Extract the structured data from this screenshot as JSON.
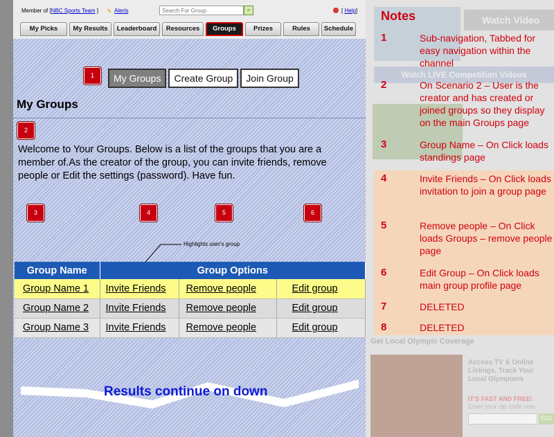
{
  "header": {
    "member_prefix": "Member of [",
    "member_team": "NBC Sports Team",
    "member_suffix": " ]",
    "alerts": "Alerts",
    "search_placeholder": "Search For Group",
    "help_prefix": "[",
    "help": "Help",
    "help_suffix": "]"
  },
  "nav": {
    "tabs": [
      {
        "label": "My Picks",
        "active": false
      },
      {
        "label": "My Results",
        "active": false
      },
      {
        "label": "Leaderboard",
        "active": false
      },
      {
        "label": "Resources",
        "active": false
      },
      {
        "label": "Groups",
        "active": true
      },
      {
        "label": "Prizes",
        "active": false
      },
      {
        "label": "Rules",
        "active": false
      },
      {
        "label": "Schedule",
        "active": false
      }
    ]
  },
  "subnav": {
    "my_groups": "My Groups",
    "create_group": "Create Group",
    "join_group": "Join Group"
  },
  "badges": [
    "1",
    "2",
    "3",
    "4",
    "5",
    "6"
  ],
  "page_title": "My Groups",
  "welcome": "Welcome to Your Groups. Below is a list of the groups that you are a member of.As the creator of the group, you can invite friends, remove people or Edit the settings (password). Have fun.",
  "annotation": "Highlights user's group",
  "grid": {
    "col_name": "Group Name",
    "col_options": "Group Options",
    "rows": [
      {
        "name": "Group Name 1",
        "invite": "Invite Friends",
        "remove": "Remove people",
        "edit": "Edit group"
      },
      {
        "name": "Group Name 2",
        "invite": "Invite Friends",
        "remove": "Remove people",
        "edit": "Edit group"
      },
      {
        "name": "Group Name 3",
        "invite": "Invite Friends",
        "remove": "Remove people",
        "edit": "Edit group"
      }
    ]
  },
  "continue_text": "Results continue on down",
  "notes": {
    "title": "Notes",
    "items": [
      {
        "num": "1",
        "text": "Sub-navigation, Tabbed for easy navigation within the channel"
      },
      {
        "num": "2",
        "text": "On Scenario 2 – User is the creator and has created or joined groups so they display on the main Groups page"
      },
      {
        "num": "3",
        "text": "Group Name – On Click loads standings page"
      },
      {
        "num": "4",
        "text": "Invite Friends – On Click loads invitation to join a group page"
      },
      {
        "num": "5",
        "text": "Remove people – On Click loads Groups – remove people page"
      },
      {
        "num": "6",
        "text": "Edit Group – On Click loads main group profile page"
      },
      {
        "num": "7",
        "text": "DELETED"
      },
      {
        "num": "8",
        "text": "DELETED"
      }
    ]
  },
  "background_ads": {
    "watch_video": "Watch Video",
    "watch_live": "Watch LIVE Competition Videos",
    "olympic": "Get Local Olympic Coverage",
    "access": "Access TV & Online Listings, Track Your Local Olympians",
    "fast": "IT'S FAST AND FREE!",
    "zip": "Enter your zip code now",
    "go": "GO"
  },
  "colors": {
    "accent_red": "#d1000e",
    "header_blue": "#1d5ab5",
    "highlight_yellow": "#fdfc8a"
  }
}
